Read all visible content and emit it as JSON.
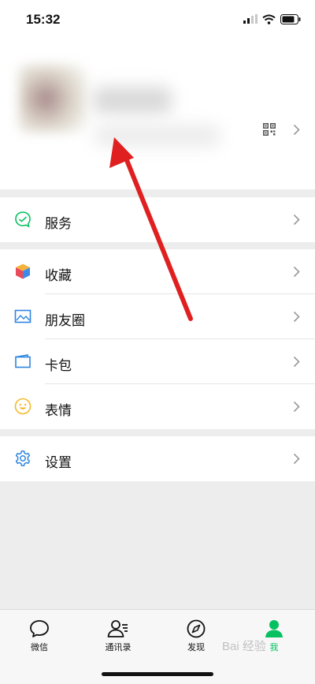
{
  "status": {
    "time": "15:32"
  },
  "menu": {
    "services": {
      "label": "服务"
    },
    "favorites": {
      "label": "收藏"
    },
    "moments": {
      "label": "朋友圈"
    },
    "cards": {
      "label": "卡包"
    },
    "stickers": {
      "label": "表情"
    },
    "settings": {
      "label": "设置"
    }
  },
  "tabs": [
    {
      "label": "微信",
      "icon": "chat-bubble-icon"
    },
    {
      "label": "通讯录",
      "icon": "contacts-icon"
    },
    {
      "label": "发现",
      "icon": "compass-icon"
    },
    {
      "label": "我",
      "icon": "person-icon",
      "active": true
    }
  ],
  "watermark": "Bai 经验",
  "colors": {
    "accent": "#07c160",
    "annotation_arrow": "#e02020",
    "background": "#ededed"
  }
}
